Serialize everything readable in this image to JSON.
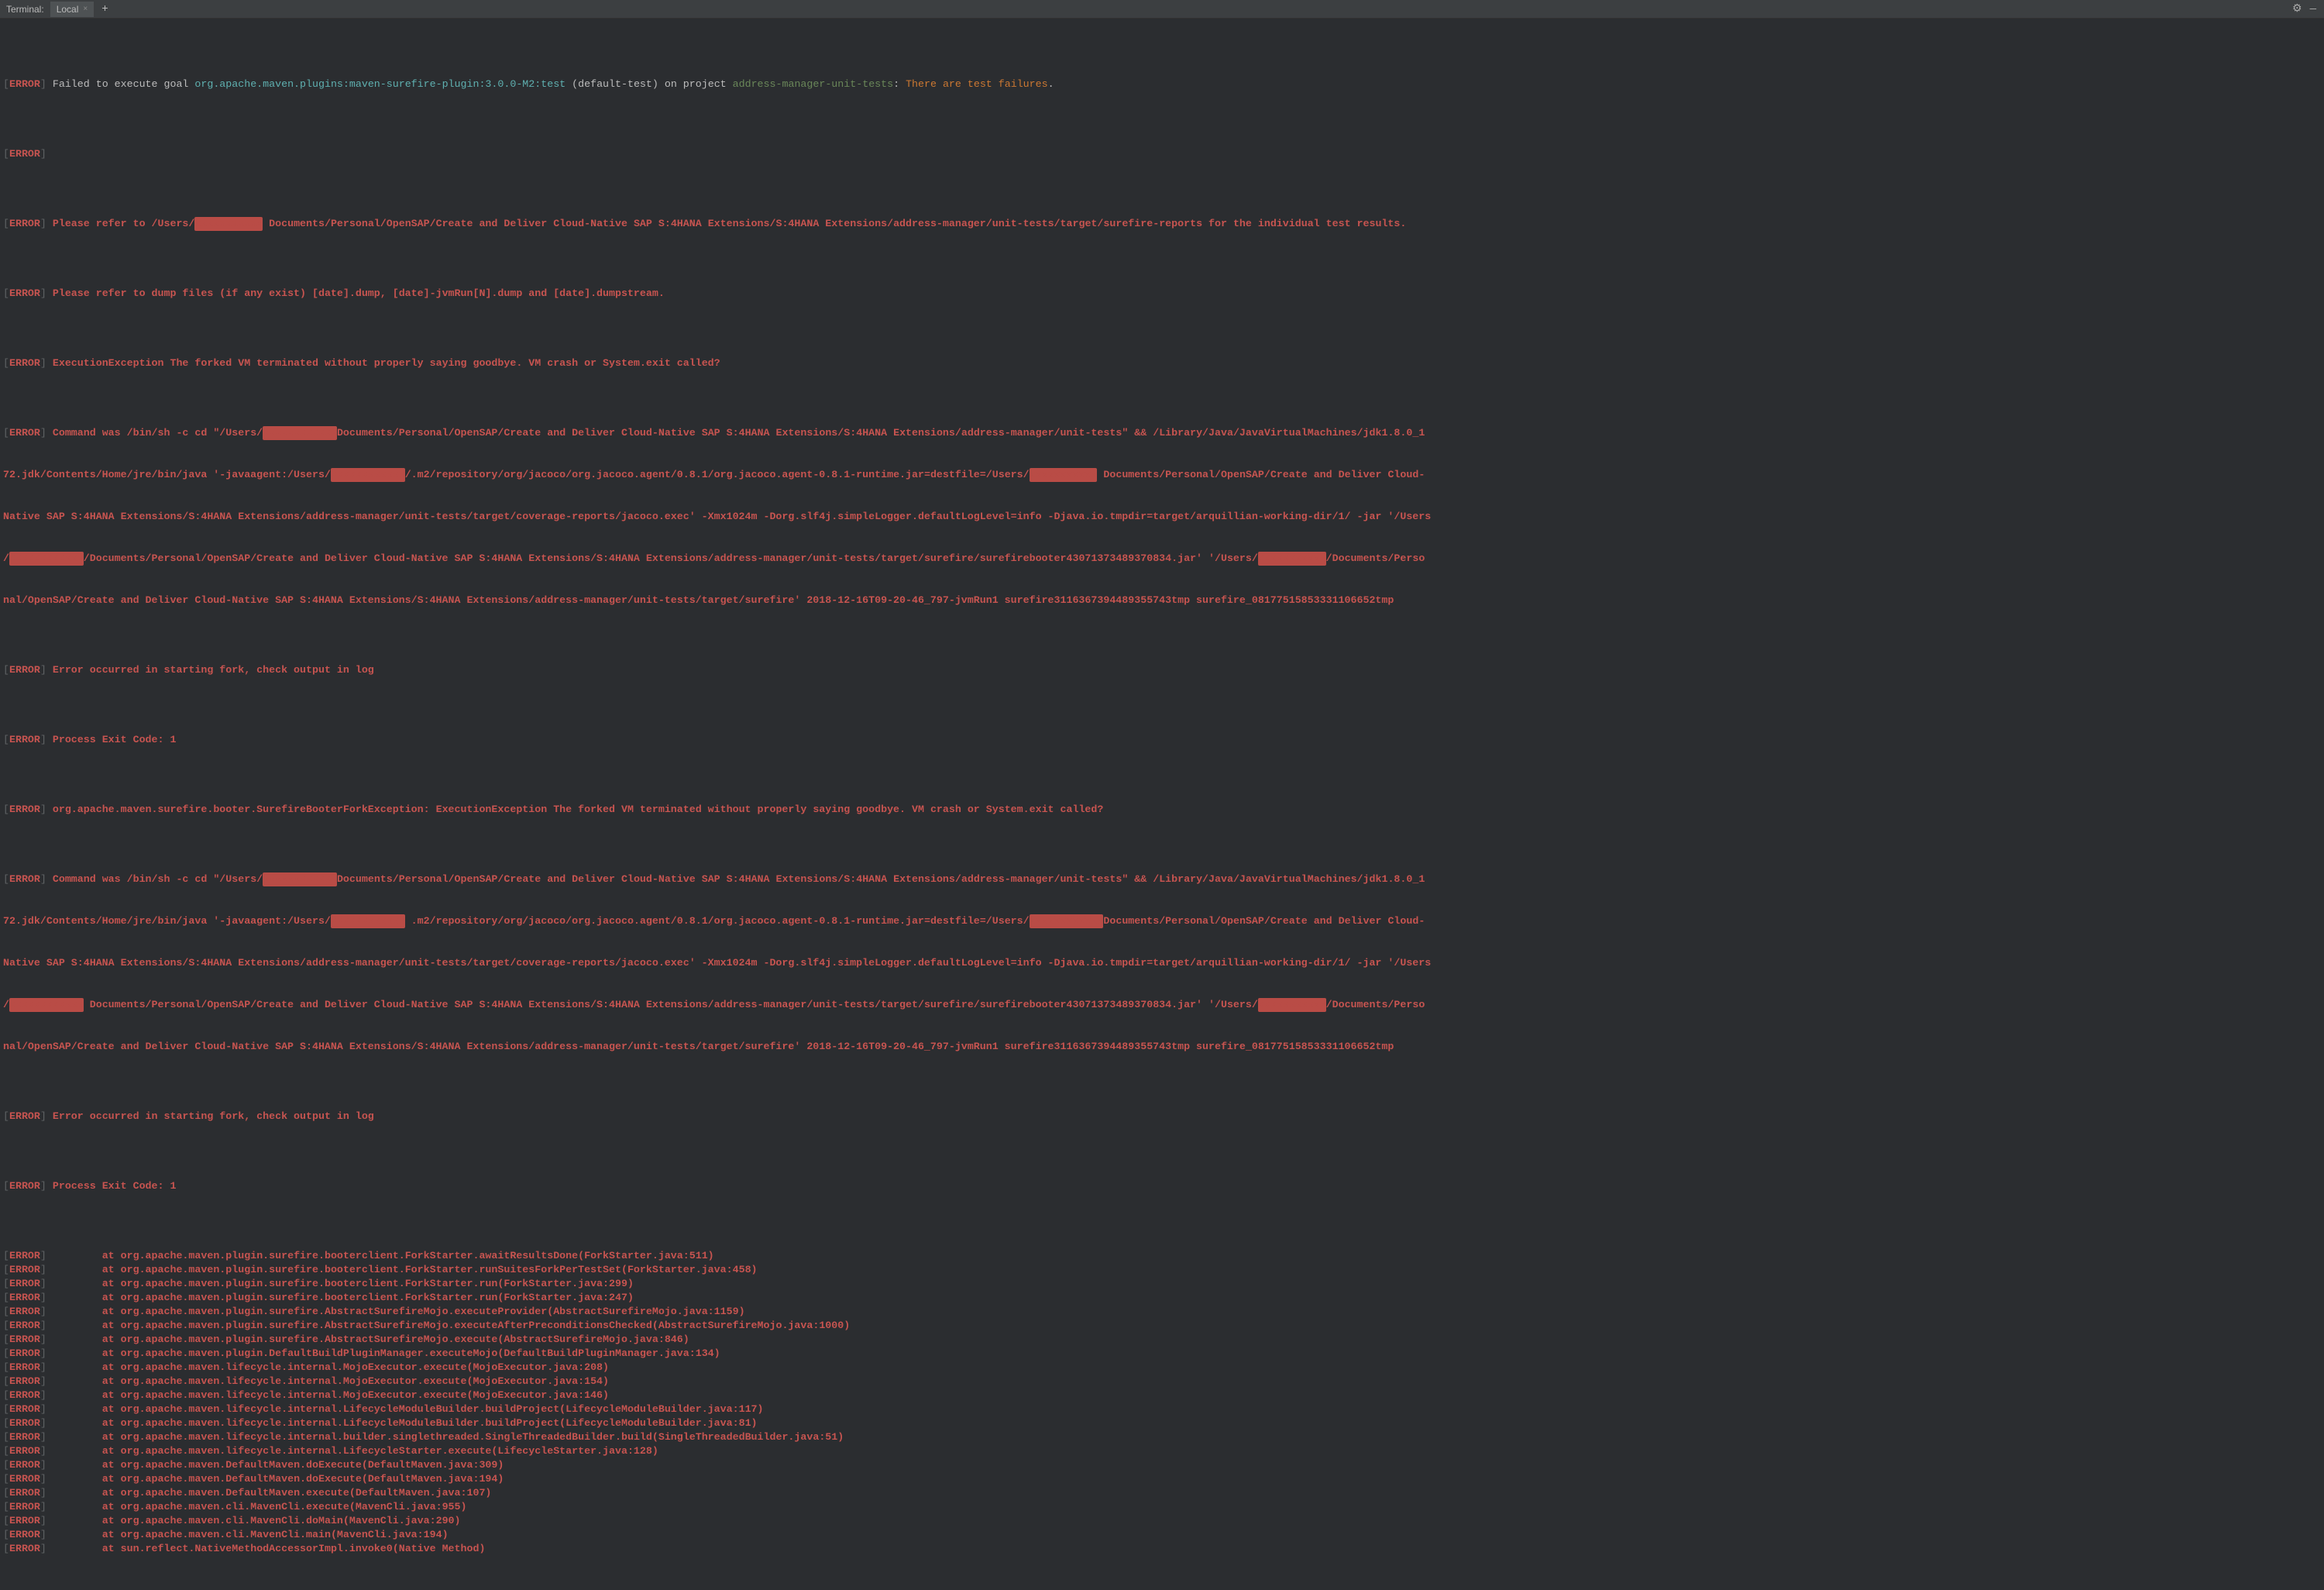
{
  "tabbar": {
    "title": "Terminal:",
    "tab_local": "Local",
    "close_glyph": "×",
    "add_glyph": "+",
    "gear_glyph": "⚙",
    "minimize_glyph": "—"
  },
  "t": {
    "ob": "[",
    "cb": "]",
    "err": "ERROR",
    "sp": " ",
    "failed": "Failed to execute goal ",
    "goal": "org.apache.maven.plugins:maven-surefire-plugin:3.0.0-M2:test",
    "default_test": " (default-test)",
    "on_project": " on project ",
    "project": "address-manager-unit-tests",
    "colon_sp": ": ",
    "failures": "There are test failures",
    "dot": ".",
    "refer_to": "Please refer to /Users/",
    "refer_to2": "Documents/Personal/OpenSAP/Create and Deliver Cloud-Native SAP S:4HANA Extensions/S:4HANA Extensions/address-manager/unit-tests/target/surefire-reports for the individual test results.",
    "refer_dump": "Please refer to dump files (if any exist) [date].dump, [date]-jvmRun[N].dump and [date].dumpstream.",
    "exec_exception": "ExecutionException The forked VM terminated without properly saying goodbye. VM crash or System.exit called?",
    "cmd_was": "Command was /bin/sh -c cd \"/Users/",
    "cmd_was2": "Documents/Personal/OpenSAP/Create and Deliver Cloud-Native SAP S:4HANA Extensions/S:4HANA Extensions/address-manager/unit-tests\" && /Library/Java/JavaVirtualMachines/jdk1.8.0_1",
    "cmd_was_cont1a": "72.jdk/Contents/Home/jre/bin/java '-javaagent:/Users/",
    "cmd_was_cont1b": "/.m2/repository/org/jacoco/org.jacoco.agent/0.8.1/org.jacoco.agent-0.8.1-runtime.jar=destfile=/Users/",
    "cmd_was_cont1c": "Documents/Personal/OpenSAP/Create and Deliver Cloud-",
    "cmd_was_cont2": "Native SAP S:4HANA Extensions/S:4HANA Extensions/address-manager/unit-tests/target/coverage-reports/jacoco.exec' -Xmx1024m -Dorg.slf4j.simpleLogger.defaultLogLevel=info -Djava.io.tmpdir=target/arquillian-working-dir/1/ -jar '/Users",
    "cmd_was_cont3a": "/",
    "cmd_was_cont3b": "/Documents/Personal/OpenSAP/Create and Deliver Cloud-Native SAP S:4HANA Extensions/S:4HANA Extensions/address-manager/unit-tests/target/surefire/surefirebooter4307137348937083­4.jar' '/Users/",
    "cmd_was_cont3c": "/Documents/Perso",
    "cmd_was_cont4": "nal/OpenSAP/Create and Deliver Cloud-Native SAP S:4HANA Extensions/S:4HANA Extensions/address-manager/unit-tests/target/surefire' 2018-12-16T09-20-46_797-jvmRun1 surefire3116367394489355743tmp surefire_08177515853331106652tmp",
    "err_fork": "Error occurred in starting fork, check output in log",
    "exit_code": "Process Exit Code: 1",
    "surefire_exception": "org.apache.maven.surefire.booter.SurefireBooterForkException: ExecutionException The forked VM terminated without properly saying goodbye. VM crash or System.exit called?",
    "cmd_was_cont1b_2": ".m2/repository/org/jacoco/org.jacoco.agent/0.8.1/org.jacoco.agent-0.8.1-runtime.jar=destfile=/Users/",
    "cmd_was_cont3a2": "Documents/Personal/OpenSAP/Create and Deliver Cloud-Native SAP S:4HANA Extensions/S:4HANA Extensions/address-manager/unit-tests/target/surefire/surefirebooter4307137348937083­4.jar' '/Users/",
    "stack": [
      "at org.apache.maven.plugin.surefire.booterclient.ForkStarter.awaitResultsDone(ForkStarter.java:511)",
      "at org.apache.maven.plugin.surefire.booterclient.ForkStarter.runSuitesForkPerTestSet(ForkStarter.java:458)",
      "at org.apache.maven.plugin.surefire.booterclient.ForkStarter.run(ForkStarter.java:299)",
      "at org.apache.maven.plugin.surefire.booterclient.ForkStarter.run(ForkStarter.java:247)",
      "at org.apache.maven.plugin.surefire.AbstractSurefireMojo.executeProvider(AbstractSurefireMojo.java:1159)",
      "at org.apache.maven.plugin.surefire.AbstractSurefireMojo.executeAfterPreconditionsChecked(AbstractSurefireMojo.java:1000)",
      "at org.apache.maven.plugin.surefire.AbstractSurefireMojo.execute(AbstractSurefireMojo.java:846)",
      "at org.apache.maven.plugin.DefaultBuildPluginManager.executeMojo(DefaultBuildPluginManager.java:134)",
      "at org.apache.maven.lifecycle.internal.MojoExecutor.execute(MojoExecutor.java:208)",
      "at org.apache.maven.lifecycle.internal.MojoExecutor.execute(MojoExecutor.java:154)",
      "at org.apache.maven.lifecycle.internal.MojoExecutor.execute(MojoExecutor.java:146)",
      "at org.apache.maven.lifecycle.internal.LifecycleModuleBuilder.buildProject(LifecycleModuleBuilder.java:117)",
      "at org.apache.maven.lifecycle.internal.LifecycleModuleBuilder.buildProject(LifecycleModuleBuilder.java:81)",
      "at org.apache.maven.lifecycle.internal.builder.singlethreaded.SingleThreadedBuilder.build(SingleThreadedBuilder.java:51)",
      "at org.apache.maven.lifecycle.internal.LifecycleStarter.execute(LifecycleStarter.java:128)",
      "at org.apache.maven.DefaultMaven.doExecute(DefaultMaven.java:309)",
      "at org.apache.maven.DefaultMaven.doExecute(DefaultMaven.java:194)",
      "at org.apache.maven.DefaultMaven.execute(DefaultMaven.java:107)",
      "at org.apache.maven.cli.MavenCli.execute(MavenCli.java:955)",
      "at org.apache.maven.cli.MavenCli.doMain(MavenCli.java:290)",
      "at org.apache.maven.cli.MavenCli.main(MavenCli.java:194)",
      "at sun.reflect.NativeMethodAccessorImpl.invoke0(Native Method)"
    ],
    "redact_short": "xxxxxxxxxxx",
    "redact_med": "xxxxxxxxxxxx"
  }
}
